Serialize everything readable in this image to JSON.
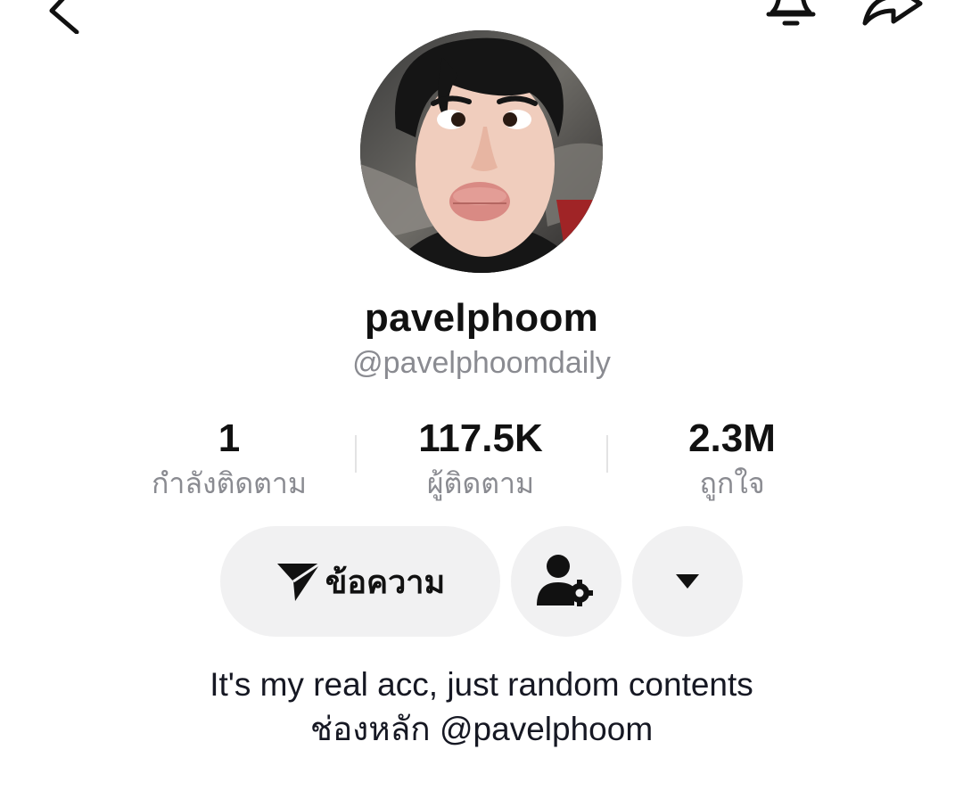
{
  "profile": {
    "display_name": "pavelphoom",
    "username": "@pavelphoomdaily"
  },
  "stats": [
    {
      "value": "1",
      "label": "กำลังติดตาม"
    },
    {
      "value": "117.5K",
      "label": "ผู้ติดตาม"
    },
    {
      "value": "2.3M",
      "label": "ถูกใจ"
    }
  ],
  "actions": {
    "message_label": "ข้อความ"
  },
  "bio": {
    "line1": "It's my real acc, just random contents",
    "line2": "ช่องหลัก @pavelphoom"
  },
  "icons": {
    "back": "back-arrow-icon",
    "bell": "bell-icon",
    "share": "share-icon",
    "send": "send-icon",
    "friend": "user-settings-icon",
    "more": "triangle-down-icon"
  },
  "colors": {
    "button_bg": "#f1f1f2",
    "secondary_text": "#8a8b91",
    "primary_text": "#111111"
  }
}
